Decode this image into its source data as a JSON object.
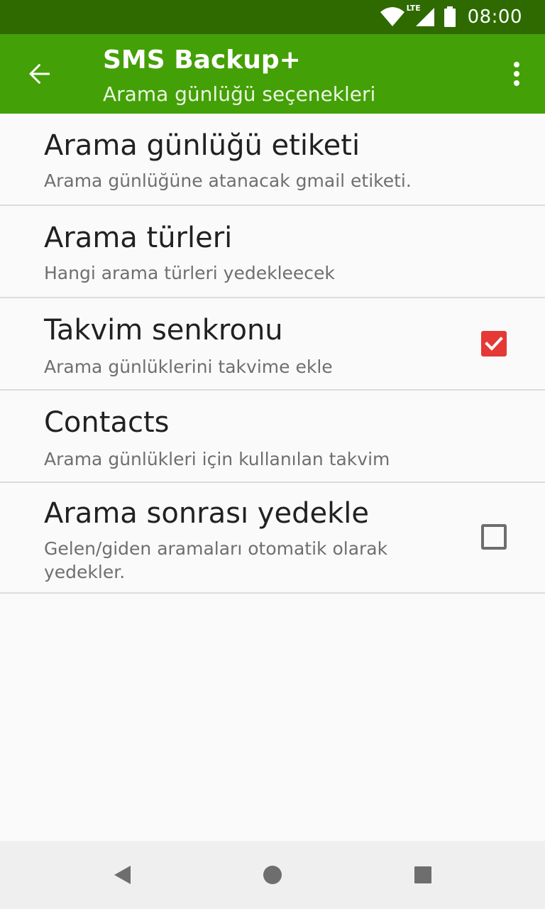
{
  "status_bar": {
    "time": "08:00",
    "network_label": "LTE",
    "icons": [
      "wifi-icon",
      "cell-signal-icon",
      "battery-icon"
    ]
  },
  "app_bar": {
    "title": "SMS Backup+",
    "subtitle": "Arama günlüğü seçenekleri",
    "background_color": "#43a006",
    "icons": [
      "back-arrow-icon",
      "overflow-menu-icon"
    ]
  },
  "preferences": [
    {
      "title": "Arama günlüğü etiketi",
      "summary": "Arama günlüğüne atanacak gmail etiketi."
    },
    {
      "title": "Arama türleri",
      "summary": "Hangi arama türleri yedekleecek"
    },
    {
      "title": "Takvim senkronu",
      "summary": "Arama günlüklerini takvime ekle",
      "checked": true
    },
    {
      "title": "Contacts",
      "summary": "Arama günlükleri için kullanılan takvim"
    },
    {
      "title": "Arama sonrası yedekle",
      "summary": "Gelen/giden aramaları otomatik olarak yedekler.",
      "checked": false
    }
  ],
  "nav_bar": {
    "icons": [
      "back-triangle-icon",
      "home-circle-icon",
      "recents-square-icon"
    ]
  },
  "colors": {
    "status_bar": "#2e6a00",
    "checkbox_checked": "#e53935"
  }
}
